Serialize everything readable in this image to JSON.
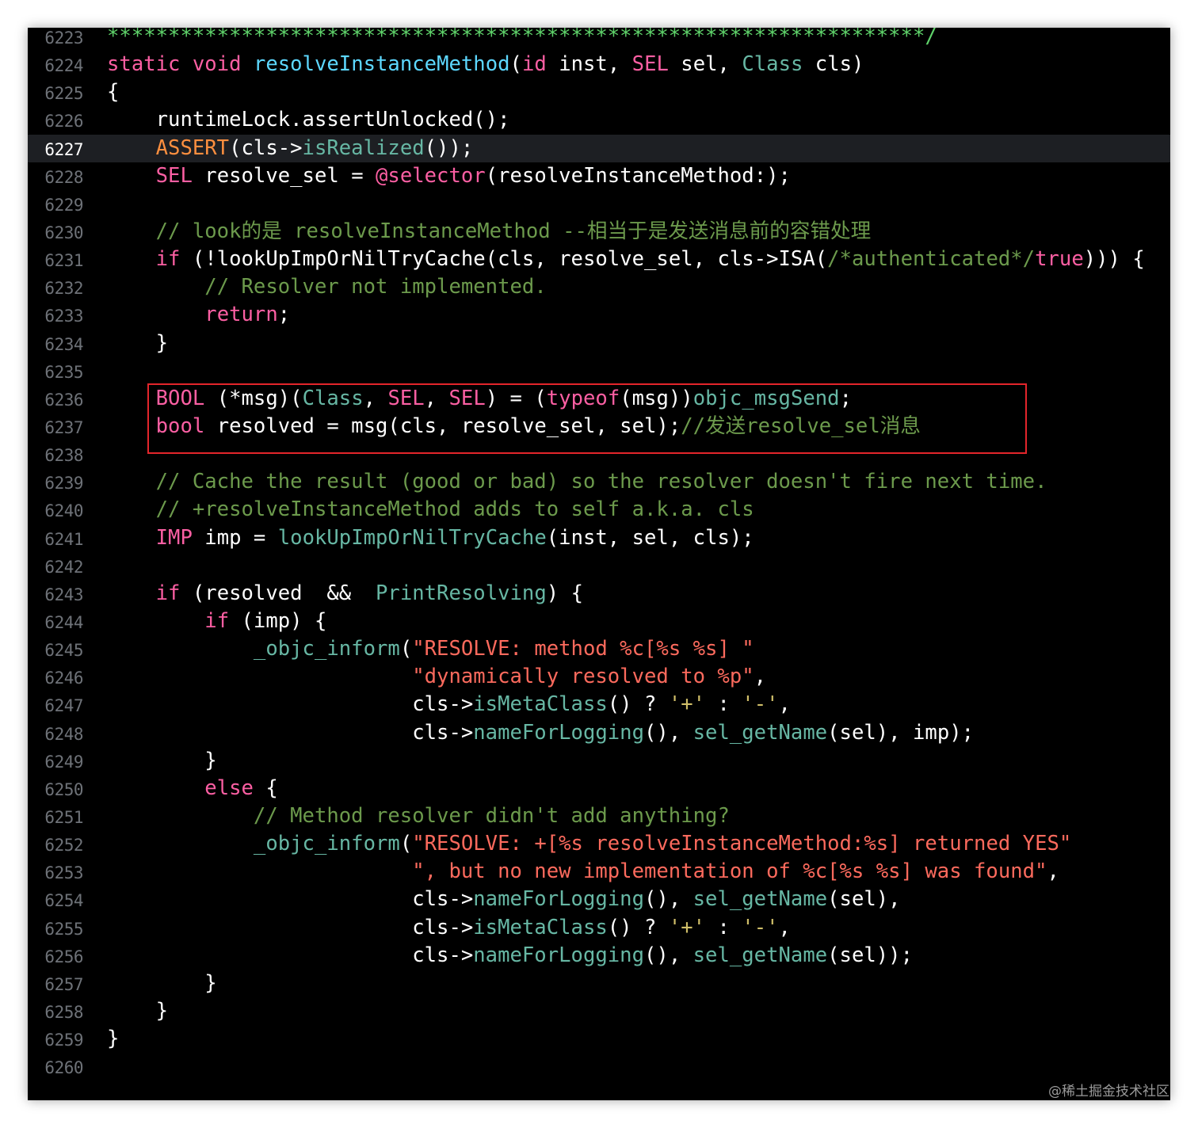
{
  "colors": {
    "background": "#000000",
    "keyword": "#fc5fa3",
    "function": "#67b7a4",
    "type": "#41a1c0",
    "macro": "#fd8f3f",
    "comment": "#6c9a4c",
    "string": "#fc6a5d",
    "highlight_border": "#e3252b"
  },
  "current_line": "6227",
  "watermark": "@稀土掘金技术社区",
  "lines": [
    {
      "num": "6223",
      "tokens": [
        [
          "cm-green",
          "*******************************************************************/"
        ]
      ]
    },
    {
      "num": "6224",
      "tokens": [
        [
          "kw",
          "static"
        ],
        [
          "p",
          " "
        ],
        [
          "kw",
          "void"
        ],
        [
          "p",
          " "
        ],
        [
          "decl",
          "resolveInstanceMethod"
        ],
        [
          "p",
          "("
        ],
        [
          "kw",
          "id"
        ],
        [
          "p",
          " inst, "
        ],
        [
          "kw",
          "SEL"
        ],
        [
          "p",
          " sel, "
        ],
        [
          "fn",
          "Class"
        ],
        [
          "p",
          " cls)"
        ]
      ]
    },
    {
      "num": "6225",
      "tokens": [
        [
          "p",
          "{"
        ]
      ]
    },
    {
      "num": "6226",
      "tokens": [
        [
          "p",
          "    runtimeLock.assertUnlocked();"
        ]
      ]
    },
    {
      "num": "6227",
      "tokens": [
        [
          "p",
          "    "
        ],
        [
          "mac",
          "ASSERT"
        ],
        [
          "p",
          "(cls->"
        ],
        [
          "fn",
          "isRealized"
        ],
        [
          "p",
          "());"
        ]
      ]
    },
    {
      "num": "6228",
      "tokens": [
        [
          "p",
          "    "
        ],
        [
          "kw",
          "SEL"
        ],
        [
          "p",
          " resolve_sel = "
        ],
        [
          "at",
          "@selector"
        ],
        [
          "p",
          "(resolveInstanceMethod:);"
        ]
      ]
    },
    {
      "num": "6229",
      "tokens": []
    },
    {
      "num": "6230",
      "tokens": [
        [
          "p",
          "    "
        ],
        [
          "cm",
          "// look的是 resolveInstanceMethod --相当于是发送消息前的容错处理"
        ]
      ]
    },
    {
      "num": "6231",
      "tokens": [
        [
          "p",
          "    "
        ],
        [
          "kw",
          "if"
        ],
        [
          "p",
          " (!lookUpImpOrNilTryCache(cls, resolve_sel, cls->ISA("
        ],
        [
          "cm",
          "/*authenticated*/"
        ],
        [
          "kw",
          "true"
        ],
        [
          "p",
          "))) {"
        ]
      ]
    },
    {
      "num": "6232",
      "tokens": [
        [
          "p",
          "        "
        ],
        [
          "cm",
          "// Resolver not implemented."
        ]
      ]
    },
    {
      "num": "6233",
      "tokens": [
        [
          "p",
          "        "
        ],
        [
          "kw",
          "return"
        ],
        [
          "p",
          ";"
        ]
      ]
    },
    {
      "num": "6234",
      "tokens": [
        [
          "p",
          "    }"
        ]
      ]
    },
    {
      "num": "6235",
      "tokens": []
    },
    {
      "num": "6236",
      "tokens": [
        [
          "p",
          "    "
        ],
        [
          "kw",
          "BOOL"
        ],
        [
          "p",
          " (*msg)("
        ],
        [
          "fn",
          "Class"
        ],
        [
          "p",
          ", "
        ],
        [
          "kw",
          "SEL"
        ],
        [
          "p",
          ", "
        ],
        [
          "kw",
          "SEL"
        ],
        [
          "p",
          ") = ("
        ],
        [
          "kw",
          "typeof"
        ],
        [
          "p",
          "(msg))"
        ],
        [
          "fn",
          "objc_msgSend"
        ],
        [
          "p",
          ";"
        ]
      ]
    },
    {
      "num": "6237",
      "tokens": [
        [
          "p",
          "    "
        ],
        [
          "kw",
          "bool"
        ],
        [
          "p",
          " resolved = msg(cls, resolve_sel, sel);"
        ],
        [
          "cm",
          "//发送resolve_sel消息"
        ]
      ]
    },
    {
      "num": "6238",
      "tokens": []
    },
    {
      "num": "6239",
      "tokens": [
        [
          "p",
          "    "
        ],
        [
          "cm",
          "// Cache the result (good or bad) so the resolver doesn't fire next time."
        ]
      ]
    },
    {
      "num": "6240",
      "tokens": [
        [
          "p",
          "    "
        ],
        [
          "cm",
          "// +resolveInstanceMethod adds to self a.k.a. cls"
        ]
      ]
    },
    {
      "num": "6241",
      "tokens": [
        [
          "p",
          "    "
        ],
        [
          "kw",
          "IMP"
        ],
        [
          "p",
          " imp = "
        ],
        [
          "fn",
          "lookUpImpOrNilTryCache"
        ],
        [
          "p",
          "(inst, sel, cls);"
        ]
      ]
    },
    {
      "num": "6242",
      "tokens": []
    },
    {
      "num": "6243",
      "tokens": [
        [
          "p",
          "    "
        ],
        [
          "kw",
          "if"
        ],
        [
          "p",
          " (resolved  &&  "
        ],
        [
          "fn",
          "PrintResolving"
        ],
        [
          "p",
          ") {"
        ]
      ]
    },
    {
      "num": "6244",
      "tokens": [
        [
          "p",
          "        "
        ],
        [
          "kw",
          "if"
        ],
        [
          "p",
          " (imp) {"
        ]
      ]
    },
    {
      "num": "6245",
      "tokens": [
        [
          "p",
          "            "
        ],
        [
          "fn",
          "_objc_inform"
        ],
        [
          "p",
          "("
        ],
        [
          "str",
          "\"RESOLVE: method %c[%s %s] \""
        ]
      ]
    },
    {
      "num": "6246",
      "tokens": [
        [
          "p",
          "                         "
        ],
        [
          "str",
          "\"dynamically resolved to %p\""
        ],
        [
          "p",
          ","
        ]
      ]
    },
    {
      "num": "6247",
      "tokens": [
        [
          "p",
          "                         cls->"
        ],
        [
          "fn",
          "isMetaClass"
        ],
        [
          "p",
          "() ? "
        ],
        [
          "ch",
          "'+'"
        ],
        [
          "p",
          " : "
        ],
        [
          "ch",
          "'-'"
        ],
        [
          "p",
          ","
        ]
      ]
    },
    {
      "num": "6248",
      "tokens": [
        [
          "p",
          "                         cls->"
        ],
        [
          "fn",
          "nameForLogging"
        ],
        [
          "p",
          "(), "
        ],
        [
          "fn",
          "sel_getName"
        ],
        [
          "p",
          "(sel), imp);"
        ]
      ]
    },
    {
      "num": "6249",
      "tokens": [
        [
          "p",
          "        }"
        ]
      ]
    },
    {
      "num": "6250",
      "tokens": [
        [
          "p",
          "        "
        ],
        [
          "kw",
          "else"
        ],
        [
          "p",
          " {"
        ]
      ]
    },
    {
      "num": "6251",
      "tokens": [
        [
          "p",
          "            "
        ],
        [
          "cm",
          "// Method resolver didn't add anything?"
        ]
      ]
    },
    {
      "num": "6252",
      "tokens": [
        [
          "p",
          "            "
        ],
        [
          "fn",
          "_objc_inform"
        ],
        [
          "p",
          "("
        ],
        [
          "str",
          "\"RESOLVE: +[%s resolveInstanceMethod:%s] returned YES\""
        ]
      ]
    },
    {
      "num": "6253",
      "tokens": [
        [
          "p",
          "                         "
        ],
        [
          "str",
          "\", but no new implementation of %c[%s %s] was found\""
        ],
        [
          "p",
          ","
        ]
      ]
    },
    {
      "num": "6254",
      "tokens": [
        [
          "p",
          "                         cls->"
        ],
        [
          "fn",
          "nameForLogging"
        ],
        [
          "p",
          "(), "
        ],
        [
          "fn",
          "sel_getName"
        ],
        [
          "p",
          "(sel),"
        ]
      ]
    },
    {
      "num": "6255",
      "tokens": [
        [
          "p",
          "                         cls->"
        ],
        [
          "fn",
          "isMetaClass"
        ],
        [
          "p",
          "() ? "
        ],
        [
          "ch",
          "'+'"
        ],
        [
          "p",
          " : "
        ],
        [
          "ch",
          "'-'"
        ],
        [
          "p",
          ","
        ]
      ]
    },
    {
      "num": "6256",
      "tokens": [
        [
          "p",
          "                         cls->"
        ],
        [
          "fn",
          "nameForLogging"
        ],
        [
          "p",
          "(), "
        ],
        [
          "fn",
          "sel_getName"
        ],
        [
          "p",
          "(sel));"
        ]
      ]
    },
    {
      "num": "6257",
      "tokens": [
        [
          "p",
          "        }"
        ]
      ]
    },
    {
      "num": "6258",
      "tokens": [
        [
          "p",
          "    }"
        ]
      ]
    },
    {
      "num": "6259",
      "tokens": [
        [
          "p",
          "}"
        ]
      ]
    },
    {
      "num": "6260",
      "tokens": []
    }
  ]
}
